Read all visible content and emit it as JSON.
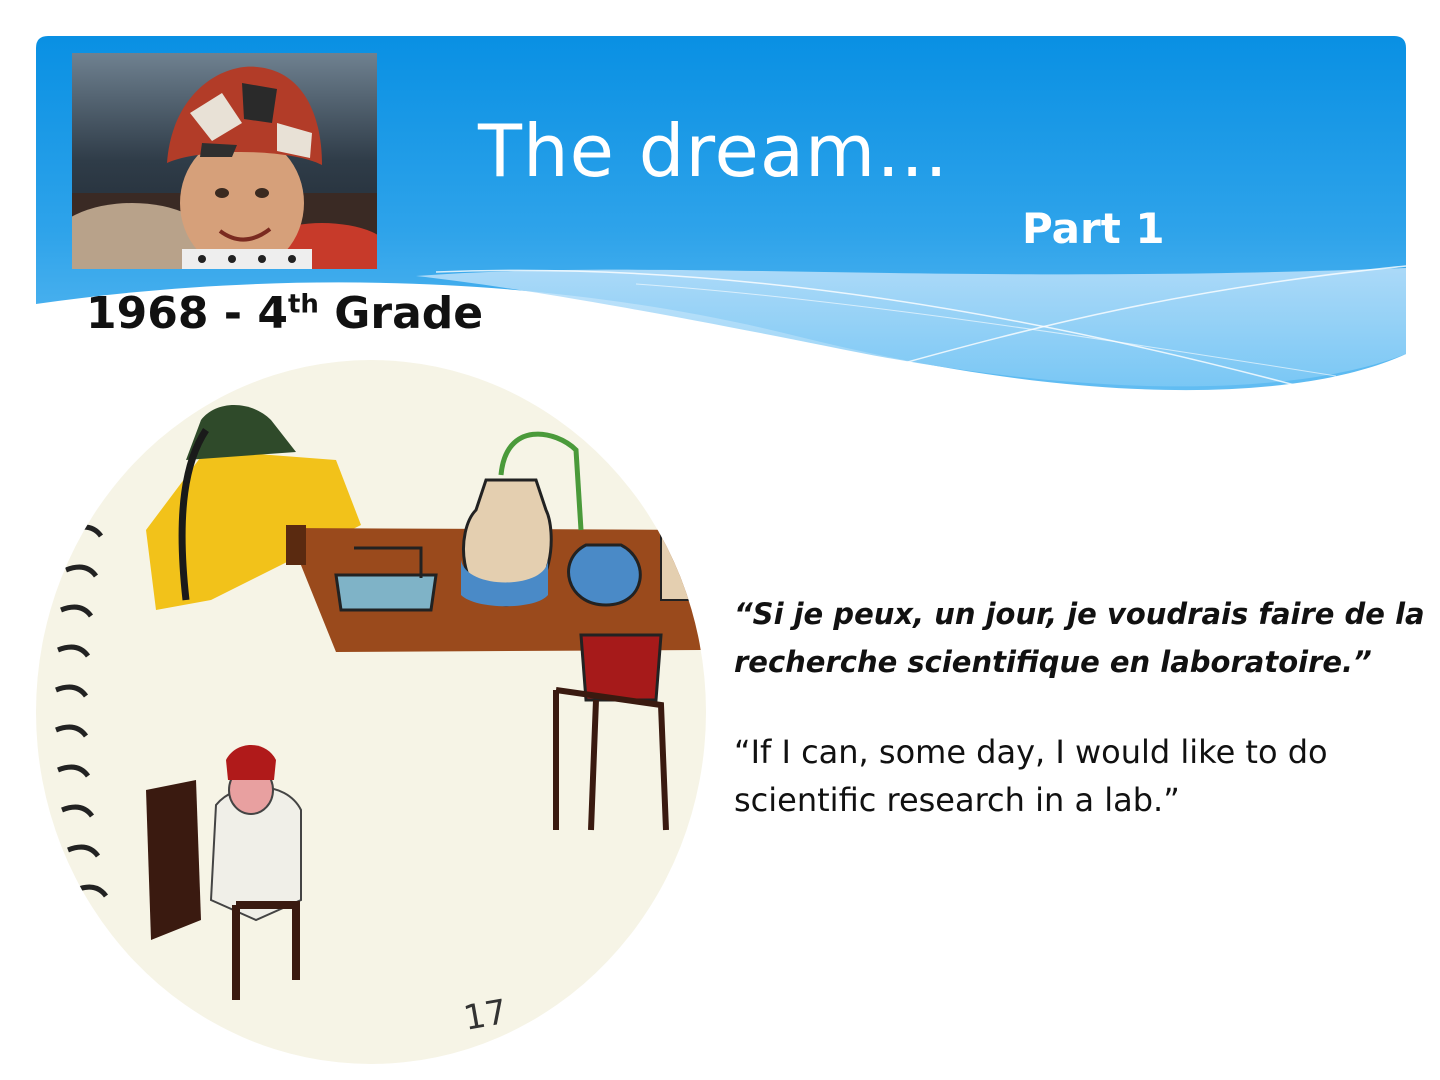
{
  "slide": {
    "title": "The dream…",
    "subtitle": "Part 1",
    "caption": {
      "year_prefix": "1968 - 4",
      "ordinal_suffix": "th",
      "rest": " Grade"
    },
    "quote_fr": "“Si je peux, un jour, je voudrais faire de la recherche scientifique en laboratoire.”",
    "quote_en": "“If I can, some day, I would like to do scientific research in a lab.”"
  },
  "images": {
    "photo": "child-portrait-photo",
    "drawing": "child-drawing-laboratory",
    "drawing_page_number": "17"
  },
  "colors": {
    "header_top": "#0b8fe0",
    "header_bottom": "#5ab8f0",
    "wave_light": "#cfe9fb",
    "text_dark": "#111111",
    "text_light": "#ffffff"
  }
}
